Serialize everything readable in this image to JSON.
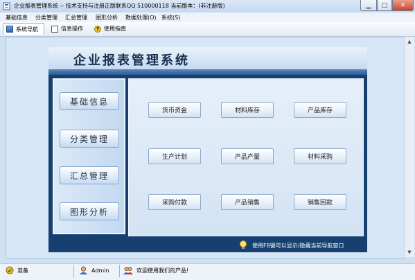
{
  "window": {
    "title": "企业报表管理系统 -- 技术支持与注册正版联系QQ 510000118    当前版本：(非注册版)"
  },
  "menu": [
    "基础信息",
    "分类管理",
    "汇总管理",
    "图形分析",
    "数据处理(O)",
    "系统(S)"
  ],
  "toolbar": {
    "nav": "系统导航",
    "info": "信息操作",
    "help": "使用指南"
  },
  "nav": {
    "title": "企业报表管理系统",
    "side": [
      "基础信息",
      "分类管理",
      "汇总管理",
      "图形分析"
    ],
    "functions": [
      [
        "货币资金",
        "材料库存",
        "产品库存"
      ],
      [
        "生产计划",
        "产品产量",
        "材料采购"
      ],
      [
        "采购付款",
        "产品销售",
        "销售回款"
      ]
    ],
    "tip": "使用F8键可以显示/隐藏当前导航窗口"
  },
  "status": {
    "state": "准备",
    "user": "Admin",
    "welcome": "欢迎使用我们的产品!"
  },
  "colors": {
    "nav_frame": "#16406f",
    "client_bg": "#d7e6f6",
    "close_button": "#c9442b"
  }
}
